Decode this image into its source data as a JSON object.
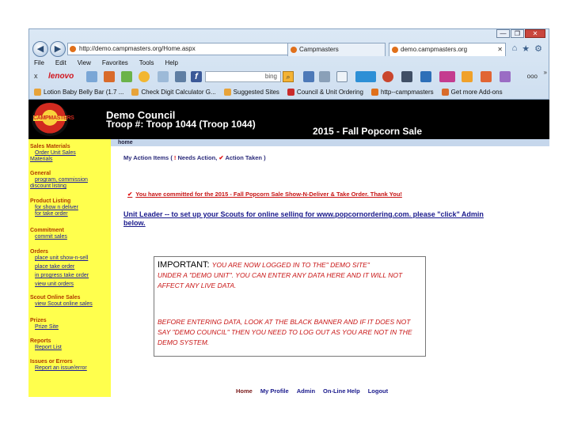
{
  "browser": {
    "address_url": "http://demo.campmasters.org/Home.aspx",
    "address_controls": "▾ ↻ ✕",
    "tabs": [
      {
        "label": "Campmasters"
      },
      {
        "label": "demo.campmasters.org"
      }
    ],
    "window_controls": [
      "—",
      "❐",
      "✕"
    ],
    "menu": [
      "File",
      "Edit",
      "View",
      "Favorites",
      "Tools",
      "Help"
    ],
    "toolbar": {
      "lenovo": "lenovo",
      "search_text": "bing",
      "more": "ooo",
      "close": "x"
    },
    "favorites": [
      "Lotion Baby Belly Bar (1.7 ...",
      "Check Digit Calculator G...",
      "Suggested Sites",
      "Council & Unit Ordering",
      "http--campmasters",
      "Get more Add-ons"
    ],
    "chevron": "»"
  },
  "banner": {
    "logo_text": "CAMPMASTERS",
    "council": "Demo Council",
    "troop": "Troop #: Troop 1044 (Troop 1044)",
    "sale": "2015 - Fall Popcorn Sale"
  },
  "sidebar": {
    "sales_materials": {
      "title": "Sales Materials",
      "links": [
        "Order Unit Sales",
        "Materials"
      ]
    },
    "general": {
      "title": "General",
      "links": [
        "program, commission",
        "discount listing"
      ]
    },
    "product_listing": {
      "title": "Product Listing",
      "links": [
        "for show n deliver",
        "for take order"
      ]
    },
    "commitment": {
      "title": "Commitment",
      "links": [
        "commit sales"
      ]
    },
    "orders": {
      "title": "Orders",
      "links": [
        "place unit show-n-sell",
        "place take order",
        "in progress take order",
        "view unit orders"
      ]
    },
    "scout_online_sales": {
      "title": "Scout Online Sales",
      "links": [
        "view Scout online sales"
      ]
    },
    "prizes": {
      "title": "Prizes",
      "links": [
        "Prize Site"
      ]
    },
    "reports": {
      "title": "Reports",
      "links": [
        "Report List"
      ]
    },
    "issues": {
      "title": "Issues or Errors",
      "links": [
        "Report an issue/error"
      ]
    }
  },
  "main": {
    "home_tab": "home",
    "action_items_label": "My Action Items (",
    "action_needed_mark": "!",
    "action_needed_label": "Needs Action,",
    "action_taken_mark": "✔",
    "action_taken_label": "Action Taken )",
    "committed_mark": "✔",
    "committed_text": "You have committed for the 2015 - Fall Popcorn Sale Show-N-Deliver & Take Order. Thank You!",
    "unit_leader_text": "Unit Leader -- to set up your Scouts for online selling for www.popcornordering.com. please \"click\" Admin below."
  },
  "important": {
    "label": "IMPORTANT:",
    "line1": "YOU ARE NOW LOGGED IN TO THE\" DEMO SITE\"",
    "para1": "UNDER A \"DEMO UNIT\". YOU CAN ENTER ANY DATA HERE AND IT WILL NOT AFFECT ANY LIVE DATA.",
    "para2": "BEFORE ENTERING DATA, LOOK AT THE BLACK BANNER AND IF IT DOES NOT SAY \"DEMO COUNCIL\" THEN YOU NEED TO LOG OUT AS YOU ARE NOT IN THE DEMO SYSTEM."
  },
  "footer": [
    "Home",
    "My Profile",
    "Admin",
    "On-Line Help",
    "Logout"
  ]
}
